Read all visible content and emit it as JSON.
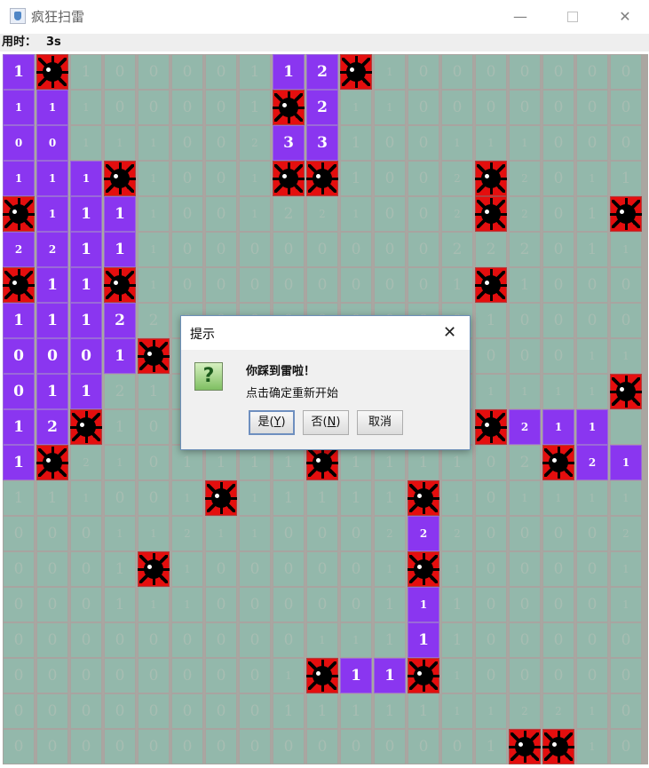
{
  "window": {
    "title": "疯狂扫雷",
    "min_glyph": "—",
    "close_glyph": "✕"
  },
  "status": {
    "time_label": "用时：",
    "time_value": "3s"
  },
  "colors": {
    "revealed": "#93b8ab",
    "flagged": "#8a36f0",
    "mine": "#e40e0e"
  },
  "board": {
    "rows": 20,
    "cols": 19,
    "grid": [
      [
        "1p",
        "*",
        "1",
        "0",
        "0",
        "0",
        "0",
        "1",
        "1p",
        "2p",
        "*",
        "1s",
        "0",
        "0",
        "0",
        "0",
        "0",
        "0",
        "0"
      ],
      [
        "1ps",
        "1ps",
        "1s",
        "0",
        "0",
        "0",
        "0",
        "1",
        "*",
        "2p",
        "1s",
        "1s",
        "0",
        "0",
        "0",
        "0",
        "0",
        "0",
        "0"
      ],
      [
        "0ps",
        "0ps",
        "1s",
        "1s",
        "1s",
        "0",
        "0",
        "2s",
        "3p",
        "3p",
        "1",
        "0",
        "0",
        "1s",
        "1s",
        "1s",
        "0",
        "0",
        "0"
      ],
      [
        "1ps",
        "1ps",
        "1ps",
        "*",
        "1s",
        "0",
        "0",
        "1s",
        "*",
        "*",
        "1",
        "0",
        "0",
        "2s",
        "*",
        "2s",
        "0",
        "1s",
        "1"
      ],
      [
        "*",
        "1ps",
        "1p",
        "1p",
        "1s",
        "0",
        "0",
        "1s",
        "2",
        "2s",
        "1s",
        "0",
        "0",
        "2s",
        "*",
        "2s",
        "0",
        "1",
        "*",
        "1p"
      ],
      [
        "2ps",
        "2ps",
        "1p",
        "1p",
        "1s",
        "0",
        "0",
        "0",
        "0",
        "0",
        "0",
        "0",
        "0",
        "2",
        "2",
        "2",
        "0",
        "1",
        "1s",
        "1s"
      ],
      [
        "*",
        "1p",
        "1p",
        "*",
        "1s",
        "0",
        "0",
        "0",
        "0",
        "0",
        "0",
        "0",
        "0",
        "1",
        "*",
        "1",
        "0",
        "0",
        "0",
        "0"
      ],
      [
        "1p",
        "1p",
        "1p",
        "2p",
        "2",
        "0",
        "0",
        "0",
        "0",
        "0",
        "0",
        "0",
        "0",
        "0",
        "1",
        "0",
        "0",
        "0",
        "0"
      ],
      [
        "0p",
        "0p",
        "0p",
        "1p",
        "*",
        "0",
        "0",
        "0",
        "0",
        "0",
        "0",
        "0",
        "0",
        "0",
        "0",
        "0",
        "0",
        "1s",
        "1s"
      ],
      [
        "0p",
        "1p",
        "1p",
        "2",
        "1",
        "0",
        "0",
        "0",
        "0",
        "0",
        "0",
        "0",
        "0",
        "1",
        "1s",
        "1s",
        "1s",
        "1s",
        "*"
      ],
      [
        "1p",
        "2p",
        "*",
        "1",
        "0",
        "0",
        "0",
        "0",
        "0",
        "0",
        "0",
        "0",
        "0",
        "2",
        "*",
        "2ps",
        "1ps",
        "1ps"
      ],
      [
        "1p",
        "*",
        "2s",
        "1s",
        "0",
        "1",
        "1",
        "1",
        "1",
        "*",
        "1",
        "1",
        "1",
        "1",
        "0",
        "2",
        "*",
        "2ps",
        "1ps",
        "1ps"
      ],
      [
        "1",
        "1",
        "1s",
        "0",
        "0",
        "1s",
        "*",
        "1s",
        "1",
        "1",
        "1",
        "1",
        "*",
        "1s",
        "0",
        "1s",
        "1s",
        "1s",
        "1s",
        "*"
      ],
      [
        "0",
        "0",
        "0",
        "1s",
        "1s",
        "2s",
        "1s",
        "1s",
        "0",
        "0",
        "0",
        "2s",
        "2ps",
        "2s",
        "0",
        "0",
        "0",
        "0",
        "2s",
        "2ps"
      ],
      [
        "0",
        "0",
        "0",
        "1",
        "*",
        "1s",
        "0",
        "0",
        "0",
        "0",
        "0",
        "1s",
        "*",
        "1s",
        "0",
        "0",
        "0",
        "0",
        "1s",
        "*"
      ],
      [
        "0",
        "0",
        "0",
        "1",
        "1s",
        "1s",
        "0",
        "0",
        "0",
        "0",
        "0",
        "1",
        "1ps",
        "1",
        "0",
        "0",
        "0",
        "0",
        "1s",
        "1s"
      ],
      [
        "0",
        "0",
        "0",
        "0",
        "0",
        "0",
        "0",
        "0",
        "0",
        "1s",
        "1s",
        "1",
        "1p",
        "1",
        "0",
        "0",
        "0",
        "0",
        "0",
        "0"
      ],
      [
        "0",
        "0",
        "0",
        "0",
        "0",
        "0",
        "0",
        "0",
        "1s",
        "*",
        "1p",
        "1p",
        "*",
        "1s",
        "0",
        "0",
        "0",
        "0",
        "0",
        "0"
      ],
      [
        "0",
        "0",
        "0",
        "0",
        "0",
        "0",
        "0",
        "0",
        "1",
        "1",
        "1",
        "1",
        "1",
        "1s",
        "1s",
        "2s",
        "2s",
        "1s",
        "0",
        "0"
      ],
      [
        "0",
        "0",
        "0",
        "0",
        "0",
        "0",
        "0",
        "0",
        "0",
        "0",
        "0",
        "0",
        "0",
        "0",
        "1",
        "*",
        "*",
        "1s",
        "0",
        "0"
      ]
    ]
  },
  "dialog": {
    "title": "提示",
    "close_glyph": "✕",
    "icon_glyph": "?",
    "message_line1": "你踩到雷啦！",
    "message_line2": "点击确定重新开始",
    "yes_label": "是(",
    "yes_key": "Y",
    "yes_tail": ")",
    "no_label": "否(",
    "no_key": "N",
    "no_tail": ")",
    "cancel_label": "取消"
  }
}
